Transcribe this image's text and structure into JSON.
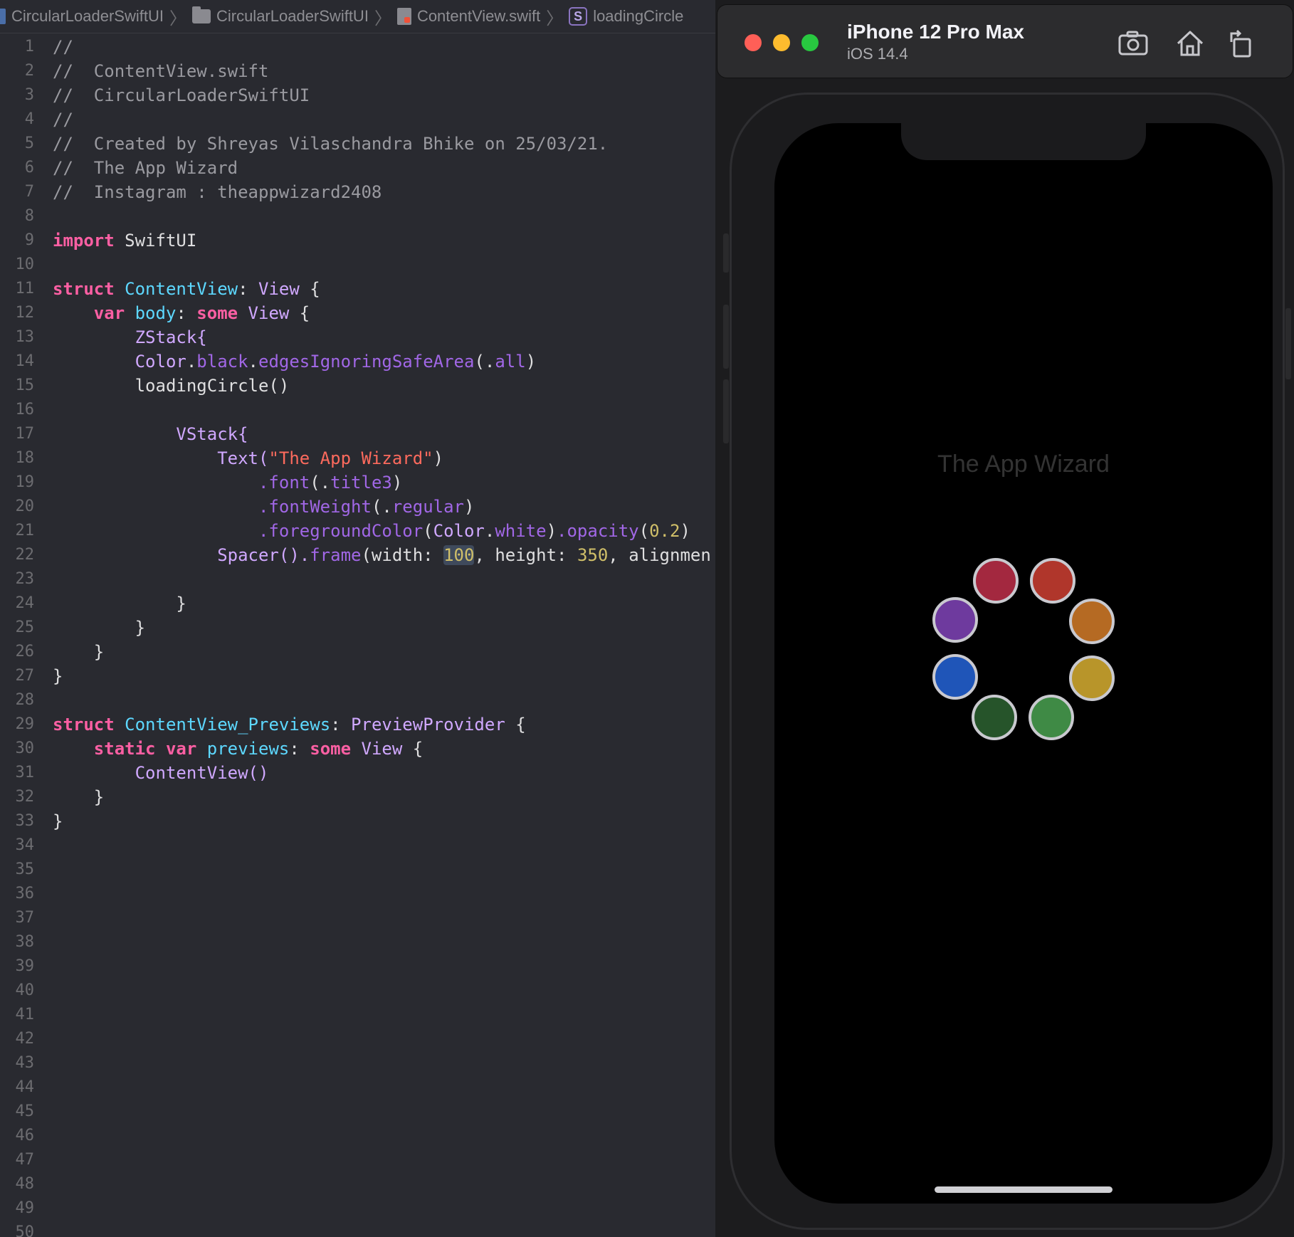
{
  "breadcrumb": {
    "project": "CircularLoaderSwiftUI",
    "folder": "CircularLoaderSwiftUI",
    "file": "ContentView.swift",
    "symbol_badge": "S",
    "symbol": "loadingCircle"
  },
  "code": {
    "line_numbers": [
      "1",
      "2",
      "3",
      "4",
      "5",
      "6",
      "7",
      "8",
      "9",
      "10",
      "11",
      "12",
      "13",
      "14",
      "15",
      "16",
      "17",
      "18",
      "19",
      "20",
      "21",
      "22",
      "23",
      "24",
      "25",
      "26",
      "27",
      "28",
      "29",
      "30",
      "31",
      "32",
      "33",
      "34",
      "35",
      "36",
      "37",
      "38",
      "39",
      "40",
      "41",
      "42",
      "43",
      "44",
      "45",
      "46",
      "47",
      "48",
      "49",
      "50"
    ],
    "line1": "//",
    "line2": "//  ContentView.swift",
    "line3": "//  CircularLoaderSwiftUI",
    "line4": "//",
    "line5": "//  Created by Shreyas Vilaschandra Bhike on 25/03/21.",
    "line6": "//  The App Wizard",
    "line7": "//  Instagram : theappwizard2408",
    "kw_import": "import",
    "swiftui": " SwiftUI",
    "kw_struct": "struct",
    "content_view": " ContentView",
    "colon": ":",
    "view": " View",
    "brace_open": " {",
    "kw_var": "var",
    "body": " body",
    "kw_some": " some",
    "zstack": "ZStack{",
    "color": "Color",
    "dot": ".",
    "black": "black",
    "edges": "edgesIgnoringSafeArea",
    "paren_dot": "(.",
    "all": "all",
    "paren_close": ")",
    "loading_circle_call": "loadingCircle()",
    "vstack": "VStack{",
    "text_open": "Text(",
    "text_string": "\"The App Wizard\"",
    "dot_font": ".font",
    "title3": "title3",
    "dot_fontweight": ".fontWeight",
    "regular": "regular",
    "dot_foreground": ".foregroundColor",
    "paren": "(",
    "white": "white",
    "dot_opacity": ".opacity",
    "opacity_value": "0.2",
    "spacer": "Spacer().",
    "frame": "frame",
    "width_label": "(width: ",
    "width_value": "100",
    "height_label": ", height: ",
    "height_value": "350",
    "alignment_label": ", alignmen",
    "brace_close": "}",
    "previews_struct": " ContentView_Previews",
    "preview_provider": " PreviewProvider",
    "kw_static": "static",
    "kw_var2": " var",
    "previews": " previews",
    "content_view_call": "ContentView()"
  },
  "simulator": {
    "device_name": "iPhone 12 Pro Max",
    "os_version": "iOS 14.4",
    "app_title": "The App Wizard",
    "toolbar_icons": [
      "screenshot-icon",
      "home-icon",
      "rotate-icon"
    ]
  },
  "loader": {
    "dots": [
      {
        "color": "#a3283f"
      },
      {
        "color": "#b0362b"
      },
      {
        "color": "#b56a23"
      },
      {
        "color": "#b8952a"
      },
      {
        "color": "#3f8a45"
      },
      {
        "color": "#26542a"
      },
      {
        "color": "#1f55b8"
      },
      {
        "color": "#6e3a9e"
      }
    ]
  }
}
